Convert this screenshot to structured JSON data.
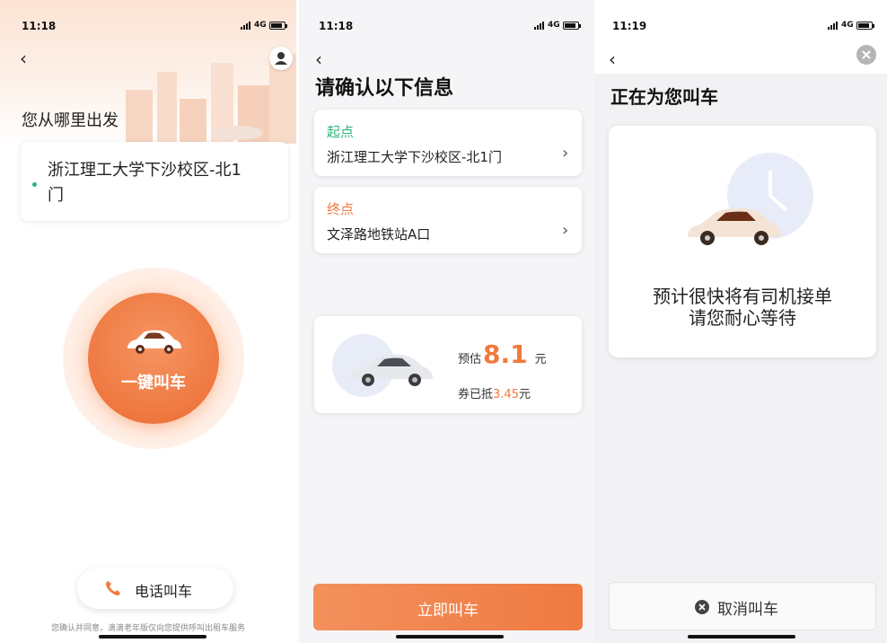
{
  "screen1": {
    "status": {
      "time": "11:18",
      "network": "4G"
    },
    "heading": "您从哪里出发",
    "origin_line1": "浙江理工大学下沙校区-北1",
    "origin_line2": "门",
    "call_button_label": "一键叫车",
    "phone_button_label": "电话叫车",
    "footer_text": "您确认并同意，滴滴老年版仅向您提供呼叫出租车服务"
  },
  "screen2": {
    "status": {
      "time": "11:18",
      "network": "4G"
    },
    "title": "请确认以下信息",
    "start": {
      "label": "起点",
      "value": "浙江理工大学下沙校区-北1门"
    },
    "end": {
      "label": "终点",
      "value": "文泽路地铁站A口"
    },
    "estimate": {
      "prefix": "预估",
      "price": "8.1",
      "unit": "元",
      "coupon_prefix": "券已抵",
      "coupon_amount": "3.45",
      "coupon_unit": "元"
    },
    "confirm_button": "立即叫车"
  },
  "screen3": {
    "status": {
      "time": "11:19",
      "network": "4G"
    },
    "title": "正在为您叫车",
    "message_line1": "预计很快将有司机接单",
    "message_line2": "请您耐心等待",
    "cancel_button": "取消叫车"
  },
  "colors": {
    "orange": "#f07a3e",
    "green": "#2fb37c",
    "price_orange": "#f07a3e"
  }
}
